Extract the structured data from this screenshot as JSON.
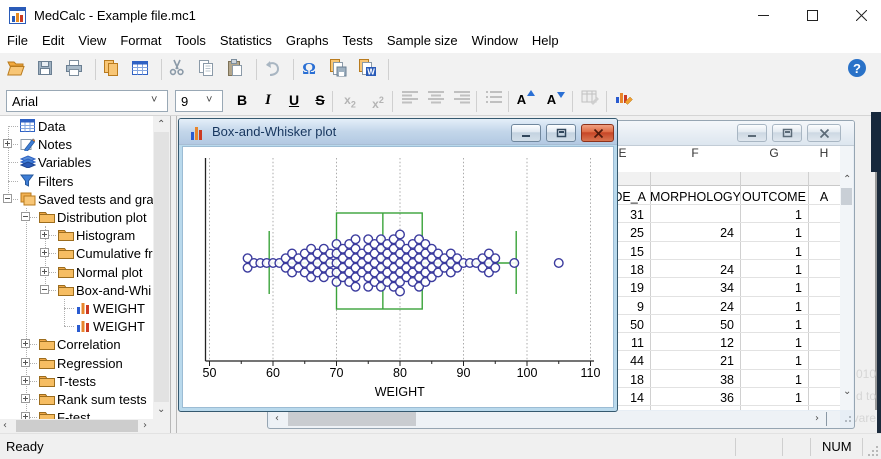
{
  "window": {
    "title": "MedCalc - Example file.mc1"
  },
  "menu": {
    "items": [
      "File",
      "Edit",
      "View",
      "Format",
      "Tools",
      "Statistics",
      "Graphs",
      "Tests",
      "Sample size",
      "Window",
      "Help"
    ]
  },
  "toolbar": {
    "buttons": [
      "open",
      "save",
      "print",
      "|",
      "copy-page",
      "data-grid",
      "|",
      "cut",
      "copy",
      "paste",
      "|",
      "undo",
      "|",
      "special-character",
      "save-add",
      "export",
      "|"
    ],
    "help": "?"
  },
  "format_bar": {
    "font_name": "Arial",
    "font_size": "9",
    "bold": "B",
    "italic": "I",
    "underline": "U",
    "strike": "S",
    "subscript": "x2",
    "superscript": "x2"
  },
  "tree": {
    "items": [
      {
        "label": "Data",
        "level": 0,
        "exp": "",
        "icon": "table"
      },
      {
        "label": "Notes",
        "level": 0,
        "exp": "+",
        "icon": "notes"
      },
      {
        "label": "Variables",
        "level": 0,
        "exp": "",
        "icon": "layers"
      },
      {
        "label": "Filters",
        "level": 0,
        "exp": "",
        "icon": "filter"
      },
      {
        "label": "Saved tests and grap",
        "level": 0,
        "exp": "-",
        "icon": "stack"
      },
      {
        "label": "Distribution plot",
        "level": 1,
        "exp": "-",
        "icon": "folder"
      },
      {
        "label": "Histogram",
        "level": 2,
        "exp": "+",
        "icon": "folder"
      },
      {
        "label": "Cumulative fr",
        "level": 2,
        "exp": "+",
        "icon": "folder"
      },
      {
        "label": "Normal plot",
        "level": 2,
        "exp": "+",
        "icon": "folder"
      },
      {
        "label": "Box-and-Whi",
        "level": 2,
        "exp": "-",
        "icon": "folder"
      },
      {
        "label": "WEIGHT",
        "level": 3,
        "exp": "",
        "icon": "chart"
      },
      {
        "label": "WEIGHT",
        "level": 3,
        "exp": "",
        "icon": "chart"
      },
      {
        "label": "Correlation",
        "level": 1,
        "exp": "+",
        "icon": "folder"
      },
      {
        "label": "Regression",
        "level": 1,
        "exp": "+",
        "icon": "folder"
      },
      {
        "label": "T-tests",
        "level": 1,
        "exp": "+",
        "icon": "folder"
      },
      {
        "label": "Rank sum tests",
        "level": 1,
        "exp": "+",
        "icon": "folder"
      },
      {
        "label": "F-test",
        "level": 1,
        "exp": "+",
        "icon": "folder"
      }
    ]
  },
  "plot_window": {
    "title": "Box-and-Whisker plot"
  },
  "chart_data": {
    "type": "box-and-whisker",
    "title": "Box-and-Whisker plot",
    "xlabel": "WEIGHT",
    "xlim": [
      50,
      110
    ],
    "xticks": [
      50,
      60,
      70,
      80,
      90,
      100,
      110
    ],
    "box": {
      "whisker_low": 59.4,
      "q1": 70,
      "median": 77.3,
      "q3": 83.5,
      "whisker_high": 98.3
    },
    "outliers": [
      105
    ],
    "points": [
      [
        56,
        2
      ],
      [
        57,
        1
      ],
      [
        58,
        1
      ],
      [
        59,
        1
      ],
      [
        60,
        1
      ],
      [
        61,
        1
      ],
      [
        62,
        2
      ],
      [
        63,
        3
      ],
      [
        64,
        2
      ],
      [
        65,
        3
      ],
      [
        66,
        4
      ],
      [
        67,
        3
      ],
      [
        68,
        4
      ],
      [
        69,
        3
      ],
      [
        70,
        5
      ],
      [
        71,
        4
      ],
      [
        72,
        5
      ],
      [
        73,
        6
      ],
      [
        74,
        3
      ],
      [
        75,
        6
      ],
      [
        76,
        5
      ],
      [
        77,
        6
      ],
      [
        78,
        5
      ],
      [
        79,
        6
      ],
      [
        80,
        7
      ],
      [
        81,
        4
      ],
      [
        82,
        5
      ],
      [
        83,
        6
      ],
      [
        84,
        5
      ],
      [
        85,
        4
      ],
      [
        86,
        3
      ],
      [
        87,
        2
      ],
      [
        88,
        3
      ],
      [
        89,
        2
      ],
      [
        90,
        1
      ],
      [
        91,
        1
      ],
      [
        92,
        1
      ],
      [
        93,
        2
      ],
      [
        94,
        3
      ],
      [
        95,
        2
      ],
      [
        98,
        1
      ],
      [
        105,
        1
      ]
    ]
  },
  "sheet_window": {
    "columns": [
      {
        "letter": "E",
        "name": "DE_A"
      },
      {
        "letter": "F",
        "name": "MORPHOLOGY"
      },
      {
        "letter": "G",
        "name": "OUTCOME"
      },
      {
        "letter": "H",
        "name": "A"
      }
    ],
    "rows": [
      [
        "31",
        "",
        "1"
      ],
      [
        "25",
        "24",
        "1"
      ],
      [
        "15",
        "",
        "1"
      ],
      [
        "18",
        "24",
        "1"
      ],
      [
        "19",
        "34",
        "1"
      ],
      [
        "9",
        "24",
        "1"
      ],
      [
        "50",
        "50",
        "1"
      ],
      [
        "11",
        "12",
        "1"
      ],
      [
        "44",
        "21",
        "1"
      ],
      [
        "18",
        "38",
        "1"
      ],
      [
        "14",
        "36",
        "1"
      ]
    ]
  },
  "status": {
    "ready": "Ready",
    "num": "NUM"
  },
  "watermark": {
    "lines": [
      "010",
      "d to",
      "vare"
    ]
  }
}
